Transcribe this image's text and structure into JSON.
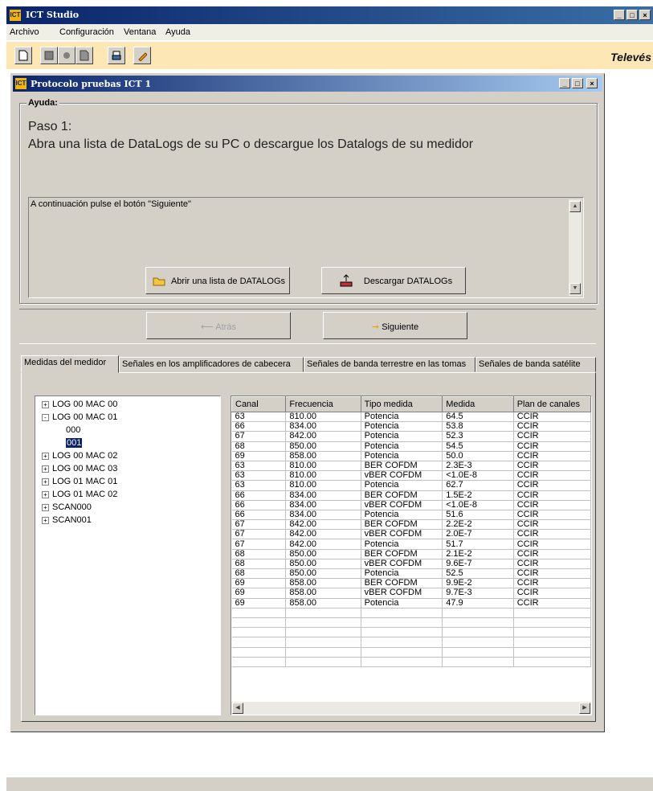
{
  "app": {
    "title": "ICT Studio",
    "logo_text": "ICT",
    "brand": "Televés"
  },
  "menu": [
    "Archivo",
    "Configuración",
    "Ventana",
    "Ayuda"
  ],
  "toolbar": {
    "icons": [
      "new-document-icon",
      "save-icon",
      "properties-icon",
      "export-icon",
      "print-icon",
      "edit-icon"
    ]
  },
  "child_window": {
    "title": "Protocolo pruebas ICT 1",
    "logo_text": "ICT"
  },
  "help": {
    "legend": "Ayuda:",
    "step_title": "Paso 1:",
    "step_text": "Abra una lista de DataLogs de su PC o descargue los Datalogs de su medidor",
    "note": "A continuación pulse el botón \"Siguiente\""
  },
  "buttons": {
    "open_list": "Abrir una lista de DATALOGs",
    "download": "Descargar DATALOGs",
    "back": "Atrás",
    "next": "Siguiente"
  },
  "tabs": [
    "Medidas del medidor",
    "Señales en los amplificadores de cabecera",
    "Señales de banda terrestre en las tomas",
    "Señales de banda satélite"
  ],
  "tree": [
    {
      "label": "LOG 00 MAC 00",
      "expander": "+"
    },
    {
      "label": "LOG 00 MAC 01",
      "expander": "-"
    },
    {
      "label": "000",
      "expander": ""
    },
    {
      "label": "001",
      "expander": ""
    },
    {
      "label": "LOG 00 MAC 02",
      "expander": "+"
    },
    {
      "label": "LOG 00 MAC 03",
      "expander": "+"
    },
    {
      "label": "LOG 01 MAC 01",
      "expander": "+"
    },
    {
      "label": "LOG 01 MAC 02",
      "expander": "+"
    },
    {
      "label": "SCAN000",
      "expander": "+"
    },
    {
      "label": "SCAN001",
      "expander": "+"
    }
  ],
  "table": {
    "columns": [
      "Canal",
      "Frecuencia",
      "Tipo medida",
      "Medida",
      "Plan de canales"
    ],
    "rows": [
      [
        "63",
        "810.00",
        "Potencia",
        "64.5",
        "CCIR"
      ],
      [
        "66",
        "834.00",
        "Potencia",
        "53.8",
        "CCIR"
      ],
      [
        "67",
        "842.00",
        "Potencia",
        "52.3",
        "CCIR"
      ],
      [
        "68",
        "850.00",
        "Potencia",
        "54.5",
        "CCIR"
      ],
      [
        "69",
        "858.00",
        "Potencia",
        "50.0",
        "CCIR"
      ],
      [
        "63",
        "810.00",
        "BER COFDM",
        "2.3E-3",
        "CCIR"
      ],
      [
        "63",
        "810.00",
        "vBER COFDM",
        "<1.0E-8",
        "CCIR"
      ],
      [
        "63",
        "810.00",
        "Potencia",
        "62.7",
        "CCIR"
      ],
      [
        "66",
        "834.00",
        "BER COFDM",
        "1.5E-2",
        "CCIR"
      ],
      [
        "66",
        "834.00",
        "vBER COFDM",
        "<1.0E-8",
        "CCIR"
      ],
      [
        "66",
        "834.00",
        "Potencia",
        "51.6",
        "CCIR"
      ],
      [
        "67",
        "842.00",
        "BER COFDM",
        "2.2E-2",
        "CCIR"
      ],
      [
        "67",
        "842.00",
        "vBER COFDM",
        "2.0E-7",
        "CCIR"
      ],
      [
        "67",
        "842.00",
        "Potencia",
        "51.7",
        "CCIR"
      ],
      [
        "68",
        "850.00",
        "BER COFDM",
        "2.1E-2",
        "CCIR"
      ],
      [
        "68",
        "850.00",
        "vBER COFDM",
        "9.6E-7",
        "CCIR"
      ],
      [
        "68",
        "850.00",
        "Potencia",
        "52.5",
        "CCIR"
      ],
      [
        "69",
        "858.00",
        "BER COFDM",
        "9.9E-2",
        "CCIR"
      ],
      [
        "69",
        "858.00",
        "vBER COFDM",
        "9.7E-3",
        "CCIR"
      ],
      [
        "69",
        "858.00",
        "Potencia",
        "47.9",
        "CCIR"
      ]
    ]
  }
}
